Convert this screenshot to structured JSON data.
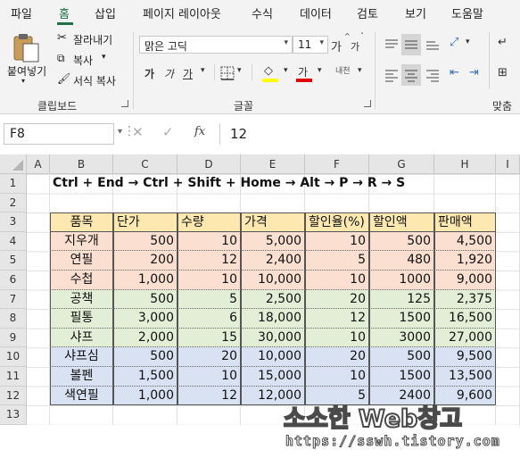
{
  "tabs": [
    "파일",
    "홈",
    "삽입",
    "페이지 레이아웃",
    "수식",
    "데이터",
    "검토",
    "보기",
    "도움말"
  ],
  "ribbon": {
    "paste_label": "붙여넣기",
    "cut_label": "잘라내기",
    "copy_label": "복사",
    "format_painter_label": "서식 복사",
    "clipboard_group": "클립보드",
    "font_name": "맑은 고딕",
    "font_size": "11",
    "font_group": "글꼴",
    "bold": "가",
    "italic": "가",
    "underline": "가",
    "grow_font": "가",
    "shrink_font": "가",
    "font_color_glyph": "가",
    "phonetic_glyph": "내천",
    "align_group": "맞춤"
  },
  "formula_bar": {
    "name_box": "F8",
    "fx": "fx",
    "formula": "12"
  },
  "sheet": {
    "columns": [
      "A",
      "B",
      "C",
      "D",
      "E",
      "F",
      "G",
      "H",
      "I"
    ],
    "rows": [
      "1",
      "2",
      "3",
      "4",
      "5",
      "6",
      "7",
      "8",
      "9",
      "10",
      "11",
      "12",
      "13"
    ],
    "instruction": "Ctrl + End → Ctrl + Shift + Home → Alt → P → R → S",
    "headers": [
      "품목",
      "단가",
      "수량",
      "가격",
      "할인율(%)",
      "할인액",
      "판매액"
    ],
    "data": [
      [
        "지우개",
        "500",
        "10",
        "5,000",
        "10",
        "500",
        "4,500"
      ],
      [
        "연필",
        "200",
        "12",
        "2,400",
        "5",
        "480",
        "1,920"
      ],
      [
        "수첩",
        "1,000",
        "10",
        "10,000",
        "10",
        "1000",
        "9,000"
      ],
      [
        "공책",
        "500",
        "5",
        "2,500",
        "20",
        "125",
        "2,375"
      ],
      [
        "필통",
        "3,000",
        "6",
        "18,000",
        "12",
        "1500",
        "16,500"
      ],
      [
        "샤프",
        "2,000",
        "15",
        "30,000",
        "10",
        "3000",
        "27,000"
      ],
      [
        "샤프심",
        "500",
        "20",
        "10,000",
        "20",
        "500",
        "9,500"
      ],
      [
        "볼펜",
        "1,500",
        "10",
        "15,000",
        "10",
        "1500",
        "13,500"
      ],
      [
        "색연필",
        "1,000",
        "12",
        "12,000",
        "5",
        "2400",
        "9,600"
      ]
    ]
  },
  "watermark": {
    "title": "소소한 Web창고",
    "url": "https://sswh.tistory.com"
  },
  "colors": {
    "header_fill": "#fde9b0",
    "group1_fill": "#fbe0d1",
    "group2_fill": "#e2efd6",
    "group3_fill": "#d8e2f2",
    "accent": "#1e7145"
  }
}
